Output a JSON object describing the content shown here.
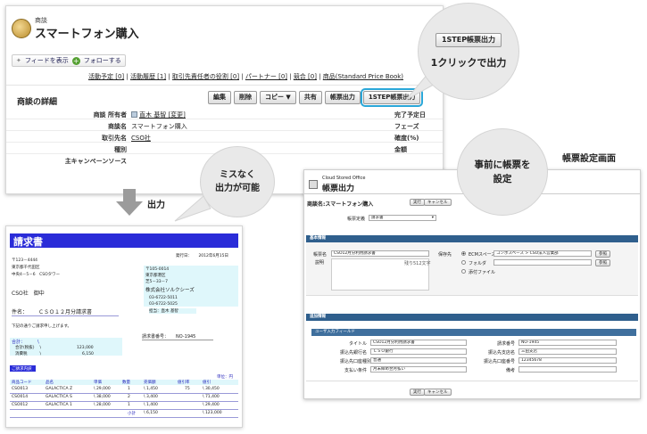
{
  "sf": {
    "object_label": "商談",
    "record_title": "スマートフォン購入",
    "feed_label": "フィードを表示",
    "follow_label": "フォローする",
    "related_links": [
      "活動予定 [0]",
      "活動履歴 [1]",
      "取引先責任者の役割 [0]",
      "パートナー [0]",
      "競合 [0]",
      "商品(Standard Price Book)"
    ],
    "detail_title": "商談の詳細",
    "buttons": [
      "編集",
      "削除",
      "コピー ▼",
      "共有",
      "帳票出力",
      "1STEP帳票出力"
    ],
    "fields": [
      {
        "label": "商談 所有者",
        "value": "直木 基智 [変更]",
        "right": "完了予定日"
      },
      {
        "label": "商談名",
        "value": "スマートフォン購入",
        "right": "フェーズ"
      },
      {
        "label": "取引先名",
        "value": "CSO社",
        "right": "確度(%)"
      },
      {
        "label": "種別",
        "value": "",
        "right": "金額"
      },
      {
        "label": "主キャンペーンソース",
        "value": "",
        "right": ""
      }
    ]
  },
  "bubbles": {
    "one_click_button": "1STEP帳票出力",
    "one_click_text": "1クリックで出力",
    "no_mistake_line1": "ミスなく",
    "no_mistake_line2": "出力が可能",
    "preset_line1": "事前に帳票を",
    "preset_line2": "設定"
  },
  "labels": {
    "output": "出力",
    "setting_screen": "帳票設定画面"
  },
  "invoice": {
    "title": "請求書",
    "issue_date_label": "発行日：",
    "issue_date": "2012年6月15日",
    "zip": "〒123－4444",
    "address1": "東京都千代田区",
    "address2": "中央4－5－6　CSOタワー",
    "client": "CSO社　御中",
    "subject_label": "件名：",
    "subject": "ＣＳＯ１２月分請求書",
    "notice": "下記の通りご請求申し上げます。",
    "total_label": "合計：",
    "total_yen": "\\",
    "subtotal_label": "合計(税抜)",
    "subtotal": "123,000",
    "tax_label": "消費税",
    "tax": "6,150",
    "vendor_zip": "〒105-0014",
    "vendor_addr1": "東京都港区",
    "vendor_addr2": "芝5－33－7",
    "vendor_name": "株式会社ソルクシーズ",
    "vendor_tel": "03-6722-5011",
    "vendor_fax": "03-6722-5025",
    "vendor_rep": "担当：直木 基智",
    "invoice_no_label": "請求書番号：",
    "invoice_no": "NO-1945",
    "detail_label": "ご請求内訳",
    "unit_label": "単位：円",
    "table_headers": [
      "商品コード",
      "品名",
      "単価",
      "数量",
      "売価額",
      "値引率",
      "値引"
    ],
    "rows": [
      [
        "CSO013",
        "GALACTICA Z",
        "\\ 29,000",
        "1",
        "\\ 1,450",
        "75",
        "\\ 30,450"
      ],
      [
        "CSO014",
        "GALACTICA S",
        "\\ 38,000",
        "2",
        "\\ 3,400",
        "",
        "\\ 71,400"
      ],
      [
        "CSO012",
        "GALACTICA 1",
        "\\ 28,000",
        "1",
        "\\ 1,400",
        "",
        "\\ 29,400"
      ]
    ],
    "sum_row_label": "小計",
    "sum_row": [
      "\\ 6,150",
      "\\ 123,000"
    ]
  },
  "form": {
    "small_title": "Cloud Stored Office",
    "title": "帳票出力",
    "record_label": "商談名:スマートフォン購入",
    "run_button": "実行",
    "cancel_button": "キャンセル",
    "doc_type_label": "帳票定義",
    "doc_type_value": "請求書",
    "section_basic": "基本情報",
    "doc_name_label": "帳票名",
    "doc_name_value": "CSO12月分利用請求書",
    "desc_label": "説明",
    "desc_hint": "残り512文字",
    "save_to_label": "保存先",
    "opt_ecm": "ECMスペース",
    "ecm_path": "コンポスペース > CSO法人営業部",
    "opt_folder": "フォルダ",
    "opt_attach": "添付ファイル",
    "ref_button": "参照",
    "section_extra": "追加情報",
    "section_user": "ユーザ入力フィールド",
    "user_fields_left": [
      {
        "label": "タイトル",
        "value": "CSO12月分利用請求書"
      },
      {
        "label": "振込先銀行名",
        "value": "ＣＳＯ銀行"
      },
      {
        "label": "振込先口座種別",
        "value": "普通"
      },
      {
        "label": "支払い条件",
        "value": "月末締め翌月払い"
      }
    ],
    "user_fields_right": [
      {
        "label": "請求番号",
        "value": "NO-1945"
      },
      {
        "label": "振込先支店名",
        "value": "三田支店"
      },
      {
        "label": "振込先口座番号",
        "value": "12345678"
      },
      {
        "label": "備考",
        "value": ""
      }
    ]
  }
}
